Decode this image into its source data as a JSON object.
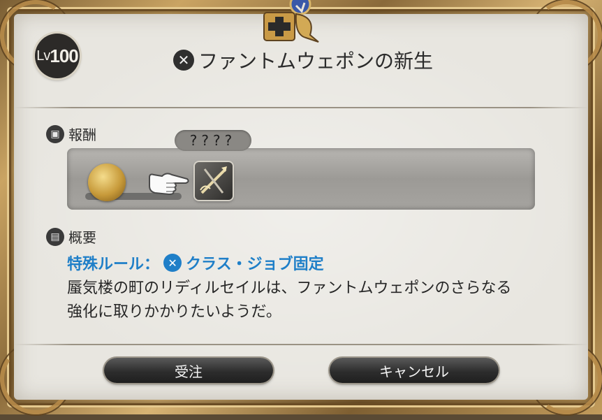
{
  "level_badge": {
    "prefix": "Lv",
    "value": "100"
  },
  "title": "ファントムウェポンの新生",
  "rewards": {
    "heading": "報酬",
    "unknown_label": "????"
  },
  "summary": {
    "heading": "概要",
    "rule_label": "特殊ルール：",
    "rule_value": "クラス・ジョブ固定",
    "description_line1": "蜃気楼の町のリディルセイルは、ファントムウェポンのさらなる",
    "description_line2": "強化に取りかかりたいようだ。"
  },
  "buttons": {
    "accept": "受注",
    "cancel": "キャンセル"
  },
  "colors": {
    "rule_blue": "#1f7fc8",
    "frame_gold": "#b68a49",
    "panel_bg": "#e8e6e0"
  }
}
